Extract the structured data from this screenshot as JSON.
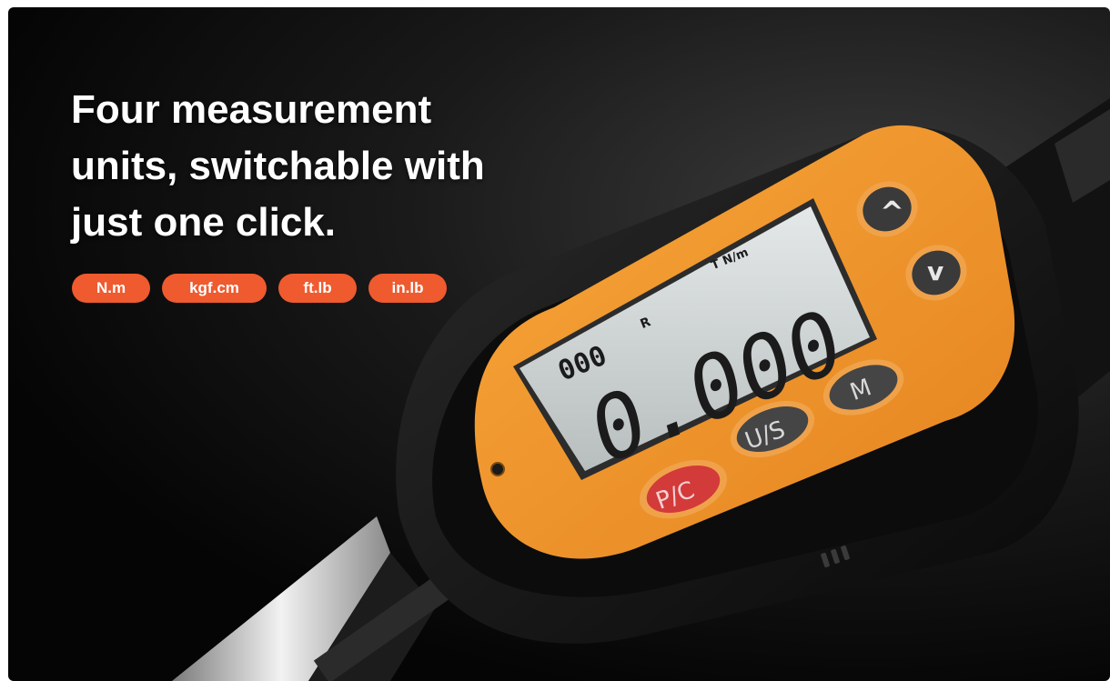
{
  "headline": {
    "line1": "Four measurement",
    "line2": "units, switchable with",
    "line3": "just one click."
  },
  "units": [
    "N.m",
    "kgf.cm",
    "ft.lb",
    "in.lb"
  ],
  "device": {
    "display": {
      "main_reading": "0.000",
      "memory_counter": "000",
      "mode_indicator": "R",
      "unit_indicator": "T N/m"
    },
    "buttons": {
      "up_symbol": "^",
      "down_symbol": "v",
      "m_label": "M",
      "us_label": "U/S",
      "pc_label": "P/C"
    }
  },
  "colors": {
    "accent": "#ef5a2f",
    "body_orange": "#f29a2e",
    "background": "#0b0b0b"
  }
}
